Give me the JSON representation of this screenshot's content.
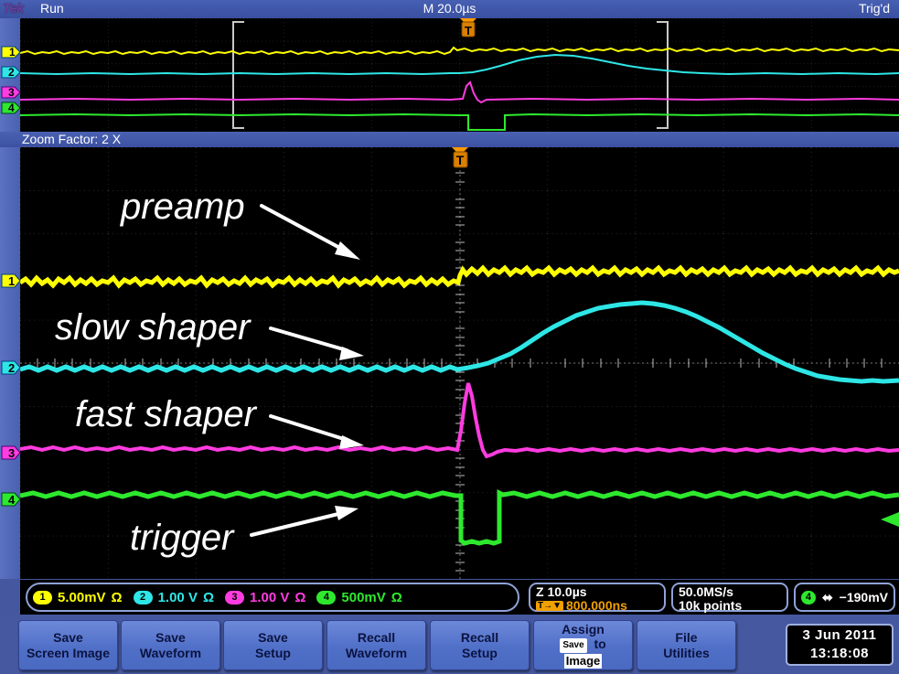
{
  "header": {
    "logo": "Tek",
    "run_state": "Run",
    "timebase": "M 20.0µs",
    "trigger_state": "Trig'd"
  },
  "zoom_bar": {
    "label": "Zoom Factor:  2 X"
  },
  "annotations": [
    {
      "text": "preamp",
      "channel": "1"
    },
    {
      "text": "slow shaper",
      "channel": "2"
    },
    {
      "text": "fast shaper",
      "channel": "3"
    },
    {
      "text": "trigger",
      "channel": "4"
    }
  ],
  "channel_markers": [
    "1",
    "2",
    "3",
    "4"
  ],
  "readout": {
    "channels": [
      {
        "num": "1",
        "scale": "5.00mV",
        "coupling": "Ω",
        "color": "#ffff00"
      },
      {
        "num": "2",
        "scale": "1.00 V",
        "coupling": "Ω",
        "color": "#2ee6e6"
      },
      {
        "num": "3",
        "scale": "1.00 V",
        "coupling": "Ω",
        "color": "#ff3ce0"
      },
      {
        "num": "4",
        "scale": "500mV",
        "coupling": "Ω",
        "color": "#2ee82e"
      }
    ],
    "zoom_timebase": "Z 10.0µs",
    "trigger_pos": "800.000ns",
    "trigger_pos_icon": "T→▼",
    "sample_rate": "50.0MS/s",
    "record_length": "10k points",
    "trigger_channel": "4",
    "trigger_slope_icon": "⬌",
    "trigger_level": "−190mV"
  },
  "menu_buttons": [
    {
      "line1": "Save",
      "line2": "Screen Image"
    },
    {
      "line1": "Save",
      "line2": "Waveform"
    },
    {
      "line1": "Save",
      "line2": "Setup"
    },
    {
      "line1": "Recall",
      "line2": "Waveform"
    },
    {
      "line1": "Recall",
      "line2": "Setup"
    },
    {
      "line1": "Assign",
      "line2": "Save to Image",
      "special": "assign"
    },
    {
      "line1": "File",
      "line2": "Utilities"
    }
  ],
  "clock": {
    "date": "3 Jun 2011",
    "time": "13:18:08"
  },
  "colors": {
    "ch1": "#ffff00",
    "ch2": "#2ee6e6",
    "ch3": "#ff3ce0",
    "ch4": "#2ee82e",
    "trigger_marker": "#ff9900",
    "graticule": "#5a5a5a",
    "background": "#000000",
    "panel": "#41559f"
  }
}
